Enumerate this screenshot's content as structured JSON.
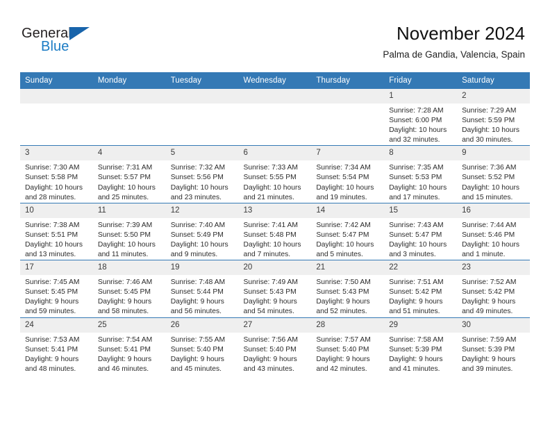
{
  "brand": {
    "name_part1": "General",
    "name_part2": "Blue",
    "logo_icon": "triangle-icon",
    "color_dark": "#231f20",
    "color_blue": "#1a7bc4"
  },
  "header": {
    "title": "November 2024",
    "subtitle": "Palma de Gandia, Valencia, Spain"
  },
  "theme": {
    "header_row_bg": "#3479b5",
    "daynum_bg": "#efefef",
    "grid_line": "#3479b5"
  },
  "weekdays": [
    "Sunday",
    "Monday",
    "Tuesday",
    "Wednesday",
    "Thursday",
    "Friday",
    "Saturday"
  ],
  "weeks": [
    [
      {
        "day": "",
        "sunrise": "",
        "sunset": "",
        "daylight_line1": "",
        "daylight_line2": ""
      },
      {
        "day": "",
        "sunrise": "",
        "sunset": "",
        "daylight_line1": "",
        "daylight_line2": ""
      },
      {
        "day": "",
        "sunrise": "",
        "sunset": "",
        "daylight_line1": "",
        "daylight_line2": ""
      },
      {
        "day": "",
        "sunrise": "",
        "sunset": "",
        "daylight_line1": "",
        "daylight_line2": ""
      },
      {
        "day": "",
        "sunrise": "",
        "sunset": "",
        "daylight_line1": "",
        "daylight_line2": ""
      },
      {
        "day": "1",
        "sunrise": "Sunrise: 7:28 AM",
        "sunset": "Sunset: 6:00 PM",
        "daylight_line1": "Daylight: 10 hours",
        "daylight_line2": "and 32 minutes."
      },
      {
        "day": "2",
        "sunrise": "Sunrise: 7:29 AM",
        "sunset": "Sunset: 5:59 PM",
        "daylight_line1": "Daylight: 10 hours",
        "daylight_line2": "and 30 minutes."
      }
    ],
    [
      {
        "day": "3",
        "sunrise": "Sunrise: 7:30 AM",
        "sunset": "Sunset: 5:58 PM",
        "daylight_line1": "Daylight: 10 hours",
        "daylight_line2": "and 28 minutes."
      },
      {
        "day": "4",
        "sunrise": "Sunrise: 7:31 AM",
        "sunset": "Sunset: 5:57 PM",
        "daylight_line1": "Daylight: 10 hours",
        "daylight_line2": "and 25 minutes."
      },
      {
        "day": "5",
        "sunrise": "Sunrise: 7:32 AM",
        "sunset": "Sunset: 5:56 PM",
        "daylight_line1": "Daylight: 10 hours",
        "daylight_line2": "and 23 minutes."
      },
      {
        "day": "6",
        "sunrise": "Sunrise: 7:33 AM",
        "sunset": "Sunset: 5:55 PM",
        "daylight_line1": "Daylight: 10 hours",
        "daylight_line2": "and 21 minutes."
      },
      {
        "day": "7",
        "sunrise": "Sunrise: 7:34 AM",
        "sunset": "Sunset: 5:54 PM",
        "daylight_line1": "Daylight: 10 hours",
        "daylight_line2": "and 19 minutes."
      },
      {
        "day": "8",
        "sunrise": "Sunrise: 7:35 AM",
        "sunset": "Sunset: 5:53 PM",
        "daylight_line1": "Daylight: 10 hours",
        "daylight_line2": "and 17 minutes."
      },
      {
        "day": "9",
        "sunrise": "Sunrise: 7:36 AM",
        "sunset": "Sunset: 5:52 PM",
        "daylight_line1": "Daylight: 10 hours",
        "daylight_line2": "and 15 minutes."
      }
    ],
    [
      {
        "day": "10",
        "sunrise": "Sunrise: 7:38 AM",
        "sunset": "Sunset: 5:51 PM",
        "daylight_line1": "Daylight: 10 hours",
        "daylight_line2": "and 13 minutes."
      },
      {
        "day": "11",
        "sunrise": "Sunrise: 7:39 AM",
        "sunset": "Sunset: 5:50 PM",
        "daylight_line1": "Daylight: 10 hours",
        "daylight_line2": "and 11 minutes."
      },
      {
        "day": "12",
        "sunrise": "Sunrise: 7:40 AM",
        "sunset": "Sunset: 5:49 PM",
        "daylight_line1": "Daylight: 10 hours",
        "daylight_line2": "and 9 minutes."
      },
      {
        "day": "13",
        "sunrise": "Sunrise: 7:41 AM",
        "sunset": "Sunset: 5:48 PM",
        "daylight_line1": "Daylight: 10 hours",
        "daylight_line2": "and 7 minutes."
      },
      {
        "day": "14",
        "sunrise": "Sunrise: 7:42 AM",
        "sunset": "Sunset: 5:47 PM",
        "daylight_line1": "Daylight: 10 hours",
        "daylight_line2": "and 5 minutes."
      },
      {
        "day": "15",
        "sunrise": "Sunrise: 7:43 AM",
        "sunset": "Sunset: 5:47 PM",
        "daylight_line1": "Daylight: 10 hours",
        "daylight_line2": "and 3 minutes."
      },
      {
        "day": "16",
        "sunrise": "Sunrise: 7:44 AM",
        "sunset": "Sunset: 5:46 PM",
        "daylight_line1": "Daylight: 10 hours",
        "daylight_line2": "and 1 minute."
      }
    ],
    [
      {
        "day": "17",
        "sunrise": "Sunrise: 7:45 AM",
        "sunset": "Sunset: 5:45 PM",
        "daylight_line1": "Daylight: 9 hours",
        "daylight_line2": "and 59 minutes."
      },
      {
        "day": "18",
        "sunrise": "Sunrise: 7:46 AM",
        "sunset": "Sunset: 5:45 PM",
        "daylight_line1": "Daylight: 9 hours",
        "daylight_line2": "and 58 minutes."
      },
      {
        "day": "19",
        "sunrise": "Sunrise: 7:48 AM",
        "sunset": "Sunset: 5:44 PM",
        "daylight_line1": "Daylight: 9 hours",
        "daylight_line2": "and 56 minutes."
      },
      {
        "day": "20",
        "sunrise": "Sunrise: 7:49 AM",
        "sunset": "Sunset: 5:43 PM",
        "daylight_line1": "Daylight: 9 hours",
        "daylight_line2": "and 54 minutes."
      },
      {
        "day": "21",
        "sunrise": "Sunrise: 7:50 AM",
        "sunset": "Sunset: 5:43 PM",
        "daylight_line1": "Daylight: 9 hours",
        "daylight_line2": "and 52 minutes."
      },
      {
        "day": "22",
        "sunrise": "Sunrise: 7:51 AM",
        "sunset": "Sunset: 5:42 PM",
        "daylight_line1": "Daylight: 9 hours",
        "daylight_line2": "and 51 minutes."
      },
      {
        "day": "23",
        "sunrise": "Sunrise: 7:52 AM",
        "sunset": "Sunset: 5:42 PM",
        "daylight_line1": "Daylight: 9 hours",
        "daylight_line2": "and 49 minutes."
      }
    ],
    [
      {
        "day": "24",
        "sunrise": "Sunrise: 7:53 AM",
        "sunset": "Sunset: 5:41 PM",
        "daylight_line1": "Daylight: 9 hours",
        "daylight_line2": "and 48 minutes."
      },
      {
        "day": "25",
        "sunrise": "Sunrise: 7:54 AM",
        "sunset": "Sunset: 5:41 PM",
        "daylight_line1": "Daylight: 9 hours",
        "daylight_line2": "and 46 minutes."
      },
      {
        "day": "26",
        "sunrise": "Sunrise: 7:55 AM",
        "sunset": "Sunset: 5:40 PM",
        "daylight_line1": "Daylight: 9 hours",
        "daylight_line2": "and 45 minutes."
      },
      {
        "day": "27",
        "sunrise": "Sunrise: 7:56 AM",
        "sunset": "Sunset: 5:40 PM",
        "daylight_line1": "Daylight: 9 hours",
        "daylight_line2": "and 43 minutes."
      },
      {
        "day": "28",
        "sunrise": "Sunrise: 7:57 AM",
        "sunset": "Sunset: 5:40 PM",
        "daylight_line1": "Daylight: 9 hours",
        "daylight_line2": "and 42 minutes."
      },
      {
        "day": "29",
        "sunrise": "Sunrise: 7:58 AM",
        "sunset": "Sunset: 5:39 PM",
        "daylight_line1": "Daylight: 9 hours",
        "daylight_line2": "and 41 minutes."
      },
      {
        "day": "30",
        "sunrise": "Sunrise: 7:59 AM",
        "sunset": "Sunset: 5:39 PM",
        "daylight_line1": "Daylight: 9 hours",
        "daylight_line2": "and 39 minutes."
      }
    ]
  ]
}
